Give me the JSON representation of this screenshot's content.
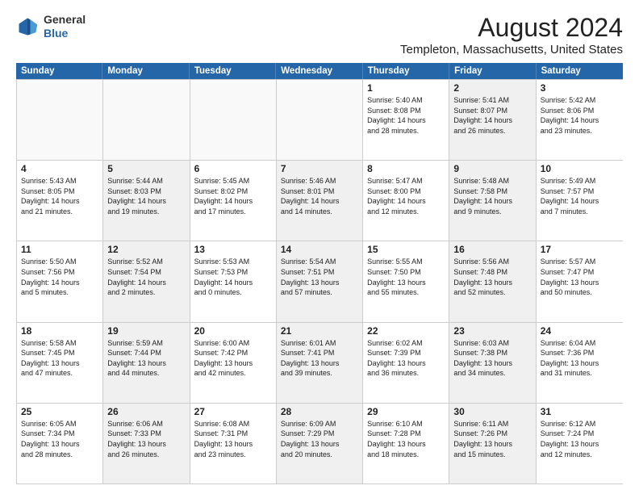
{
  "header": {
    "logo_general": "General",
    "logo_blue": "Blue",
    "month_title": "August 2024",
    "location": "Templeton, Massachusetts, United States"
  },
  "weekdays": [
    "Sunday",
    "Monday",
    "Tuesday",
    "Wednesday",
    "Thursday",
    "Friday",
    "Saturday"
  ],
  "rows": [
    [
      {
        "day": "",
        "info": "",
        "empty": true
      },
      {
        "day": "",
        "info": "",
        "empty": true
      },
      {
        "day": "",
        "info": "",
        "empty": true
      },
      {
        "day": "",
        "info": "",
        "empty": true
      },
      {
        "day": "1",
        "info": "Sunrise: 5:40 AM\nSunset: 8:08 PM\nDaylight: 14 hours\nand 28 minutes."
      },
      {
        "day": "2",
        "info": "Sunrise: 5:41 AM\nSunset: 8:07 PM\nDaylight: 14 hours\nand 26 minutes.",
        "shaded": true
      },
      {
        "day": "3",
        "info": "Sunrise: 5:42 AM\nSunset: 8:06 PM\nDaylight: 14 hours\nand 23 minutes."
      }
    ],
    [
      {
        "day": "4",
        "info": "Sunrise: 5:43 AM\nSunset: 8:05 PM\nDaylight: 14 hours\nand 21 minutes."
      },
      {
        "day": "5",
        "info": "Sunrise: 5:44 AM\nSunset: 8:03 PM\nDaylight: 14 hours\nand 19 minutes.",
        "shaded": true
      },
      {
        "day": "6",
        "info": "Sunrise: 5:45 AM\nSunset: 8:02 PM\nDaylight: 14 hours\nand 17 minutes."
      },
      {
        "day": "7",
        "info": "Sunrise: 5:46 AM\nSunset: 8:01 PM\nDaylight: 14 hours\nand 14 minutes.",
        "shaded": true
      },
      {
        "day": "8",
        "info": "Sunrise: 5:47 AM\nSunset: 8:00 PM\nDaylight: 14 hours\nand 12 minutes."
      },
      {
        "day": "9",
        "info": "Sunrise: 5:48 AM\nSunset: 7:58 PM\nDaylight: 14 hours\nand 9 minutes.",
        "shaded": true
      },
      {
        "day": "10",
        "info": "Sunrise: 5:49 AM\nSunset: 7:57 PM\nDaylight: 14 hours\nand 7 minutes."
      }
    ],
    [
      {
        "day": "11",
        "info": "Sunrise: 5:50 AM\nSunset: 7:56 PM\nDaylight: 14 hours\nand 5 minutes."
      },
      {
        "day": "12",
        "info": "Sunrise: 5:52 AM\nSunset: 7:54 PM\nDaylight: 14 hours\nand 2 minutes.",
        "shaded": true
      },
      {
        "day": "13",
        "info": "Sunrise: 5:53 AM\nSunset: 7:53 PM\nDaylight: 14 hours\nand 0 minutes."
      },
      {
        "day": "14",
        "info": "Sunrise: 5:54 AM\nSunset: 7:51 PM\nDaylight: 13 hours\nand 57 minutes.",
        "shaded": true
      },
      {
        "day": "15",
        "info": "Sunrise: 5:55 AM\nSunset: 7:50 PM\nDaylight: 13 hours\nand 55 minutes."
      },
      {
        "day": "16",
        "info": "Sunrise: 5:56 AM\nSunset: 7:48 PM\nDaylight: 13 hours\nand 52 minutes.",
        "shaded": true
      },
      {
        "day": "17",
        "info": "Sunrise: 5:57 AM\nSunset: 7:47 PM\nDaylight: 13 hours\nand 50 minutes."
      }
    ],
    [
      {
        "day": "18",
        "info": "Sunrise: 5:58 AM\nSunset: 7:45 PM\nDaylight: 13 hours\nand 47 minutes."
      },
      {
        "day": "19",
        "info": "Sunrise: 5:59 AM\nSunset: 7:44 PM\nDaylight: 13 hours\nand 44 minutes.",
        "shaded": true
      },
      {
        "day": "20",
        "info": "Sunrise: 6:00 AM\nSunset: 7:42 PM\nDaylight: 13 hours\nand 42 minutes."
      },
      {
        "day": "21",
        "info": "Sunrise: 6:01 AM\nSunset: 7:41 PM\nDaylight: 13 hours\nand 39 minutes.",
        "shaded": true
      },
      {
        "day": "22",
        "info": "Sunrise: 6:02 AM\nSunset: 7:39 PM\nDaylight: 13 hours\nand 36 minutes."
      },
      {
        "day": "23",
        "info": "Sunrise: 6:03 AM\nSunset: 7:38 PM\nDaylight: 13 hours\nand 34 minutes.",
        "shaded": true
      },
      {
        "day": "24",
        "info": "Sunrise: 6:04 AM\nSunset: 7:36 PM\nDaylight: 13 hours\nand 31 minutes."
      }
    ],
    [
      {
        "day": "25",
        "info": "Sunrise: 6:05 AM\nSunset: 7:34 PM\nDaylight: 13 hours\nand 28 minutes."
      },
      {
        "day": "26",
        "info": "Sunrise: 6:06 AM\nSunset: 7:33 PM\nDaylight: 13 hours\nand 26 minutes.",
        "shaded": true
      },
      {
        "day": "27",
        "info": "Sunrise: 6:08 AM\nSunset: 7:31 PM\nDaylight: 13 hours\nand 23 minutes."
      },
      {
        "day": "28",
        "info": "Sunrise: 6:09 AM\nSunset: 7:29 PM\nDaylight: 13 hours\nand 20 minutes.",
        "shaded": true
      },
      {
        "day": "29",
        "info": "Sunrise: 6:10 AM\nSunset: 7:28 PM\nDaylight: 13 hours\nand 18 minutes."
      },
      {
        "day": "30",
        "info": "Sunrise: 6:11 AM\nSunset: 7:26 PM\nDaylight: 13 hours\nand 15 minutes.",
        "shaded": true
      },
      {
        "day": "31",
        "info": "Sunrise: 6:12 AM\nSunset: 7:24 PM\nDaylight: 13 hours\nand 12 minutes."
      }
    ]
  ]
}
